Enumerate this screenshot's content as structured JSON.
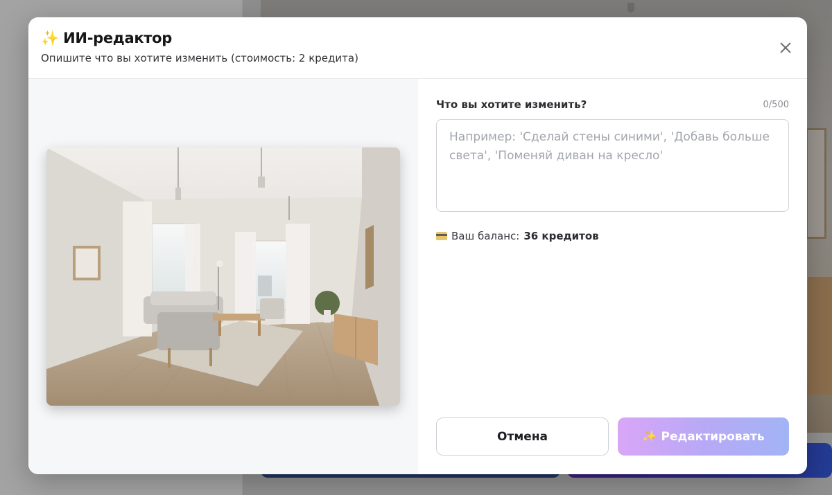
{
  "modal": {
    "title_icon": "✨",
    "title": "ИИ-редактор",
    "subtitle": "Опишите что вы хотите изменить (стоимость: 2 кредита)",
    "close_icon": "close-icon"
  },
  "form": {
    "label": "Что вы хотите изменить?",
    "char_count": "0/500",
    "value": "",
    "placeholder": "Например: 'Сделай стены синими', 'Добавь больше света', 'Поменяй диван на кресло'"
  },
  "balance": {
    "icon": "credit-card-icon",
    "label": "Ваш баланс:",
    "value": "36 кредитов"
  },
  "actions": {
    "cancel_label": "Отмена",
    "edit_icon": "✨",
    "edit_label": "Редактировать"
  },
  "colors": {
    "edit_gradient_start": "#d9a6f7",
    "edit_gradient_end": "#a2b3f6",
    "overlay": "#8d8d8d"
  }
}
